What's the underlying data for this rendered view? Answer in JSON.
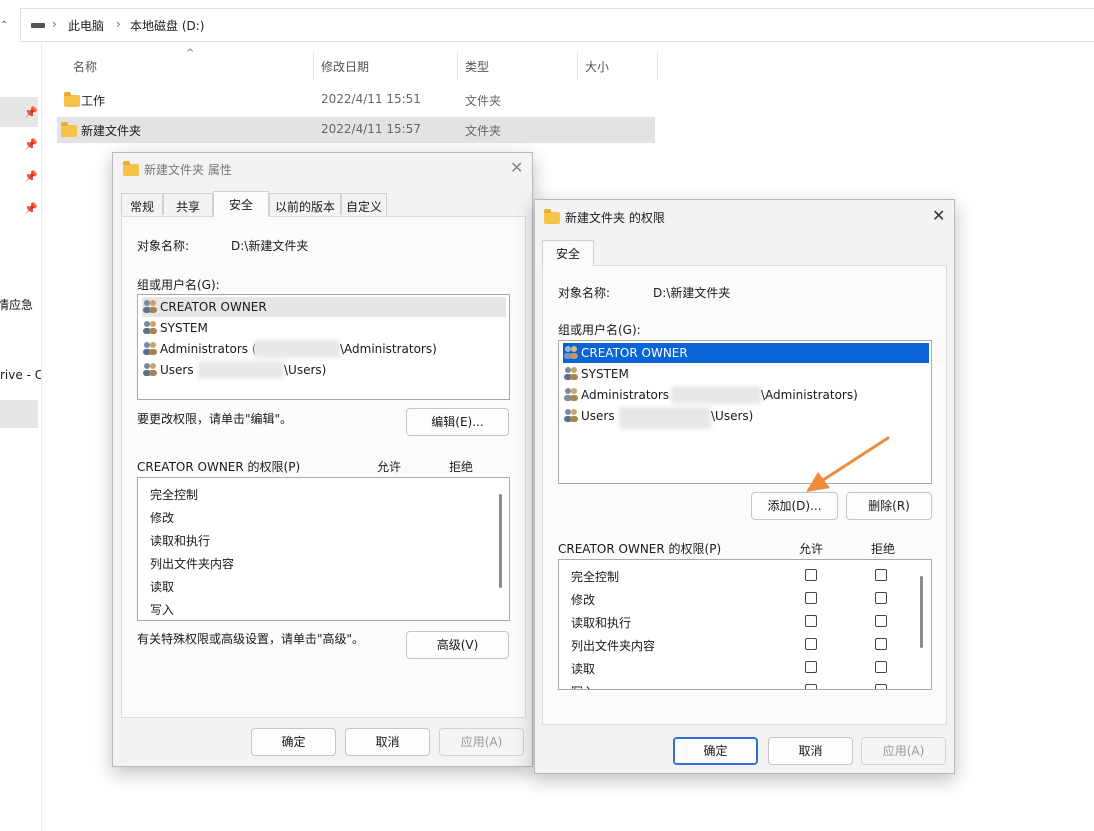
{
  "explorer": {
    "breadcrumb": [
      "此电脑",
      "本地磁盘 (D:)"
    ],
    "left_truncated": [
      "情应急",
      "rive - C"
    ],
    "columns": [
      "名称",
      "修改日期",
      "类型",
      "大小"
    ],
    "files": [
      {
        "name": "工作",
        "date": "2022/4/11 15:51",
        "type": "文件夹"
      },
      {
        "name": "新建文件夹",
        "date": "2022/4/11 15:57",
        "type": "文件夹"
      }
    ]
  },
  "props": {
    "title": "新建文件夹 属性",
    "tabs": [
      "常规",
      "共享",
      "安全",
      "以前的版本",
      "自定义"
    ],
    "object_label": "对象名称:",
    "object_value": "D:\\新建文件夹",
    "group_label": "组或用户名(G):",
    "users": [
      {
        "name": "CREATOR OWNER"
      },
      {
        "name": "SYSTEM"
      },
      {
        "name": "Administrators (",
        "suffix": "\\Administrators)"
      },
      {
        "name": "Users",
        "suffix": "\\Users)"
      }
    ],
    "edit_hint": "要更改权限，请单击\"编辑\"。",
    "edit_button": "编辑(E)...",
    "perm_title": "CREATOR OWNER 的权限(P)",
    "allow": "允许",
    "deny": "拒绝",
    "permissions": [
      "完全控制",
      "修改",
      "读取和执行",
      "列出文件夹内容",
      "读取",
      "写入"
    ],
    "advanced_hint": "有关特殊权限或高级设置，请单击\"高级\"。",
    "advanced_button": "高级(V)",
    "ok": "确定",
    "cancel": "取消",
    "apply": "应用(A)"
  },
  "perm": {
    "title": "新建文件夹 的权限",
    "tab": "安全",
    "object_label": "对象名称:",
    "object_value": "D:\\新建文件夹",
    "group_label": "组或用户名(G):",
    "users": [
      {
        "name": "CREATOR OWNER"
      },
      {
        "name": "SYSTEM"
      },
      {
        "name": "Administrators",
        "suffix": "\\Administrators)"
      },
      {
        "name": "Users",
        "suffix": "\\Users)"
      }
    ],
    "add_button": "添加(D)...",
    "remove_button": "删除(R)",
    "perm_title": "CREATOR OWNER 的权限(P)",
    "allow": "允许",
    "deny": "拒绝",
    "permissions": [
      "完全控制",
      "修改",
      "读取和执行",
      "列出文件夹内容",
      "读取",
      "写入"
    ],
    "ok": "确定",
    "cancel": "取消",
    "apply": "应用(A)"
  },
  "colors": {
    "selection": "#0a64d6",
    "arrow": "#f08a3c",
    "folder": "#f7c44a"
  }
}
